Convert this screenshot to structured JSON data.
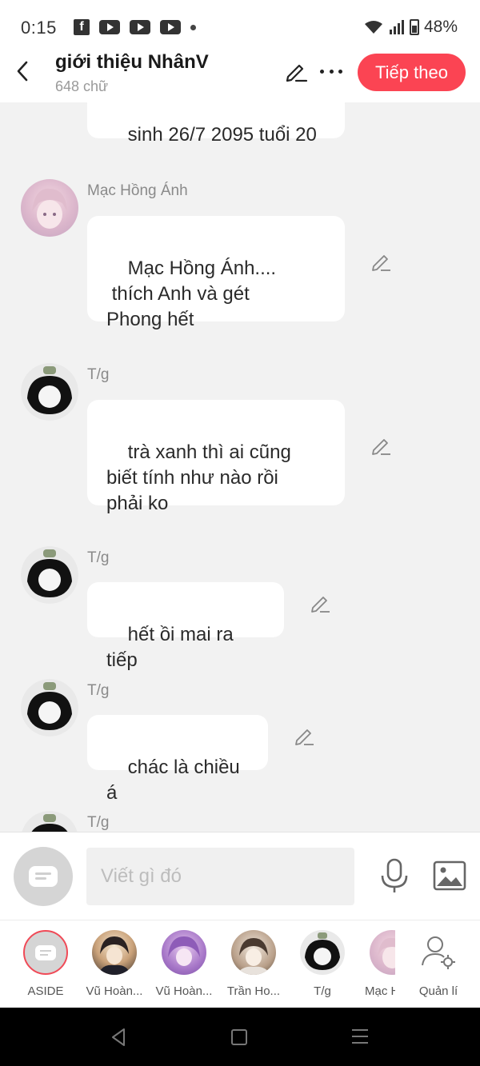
{
  "status_bar": {
    "time": "0:15",
    "battery": "48%"
  },
  "header": {
    "title": "giới thiệu NhânV",
    "word_count": "648 chữ",
    "next_button": "Tiếp theo"
  },
  "chat": {
    "messages": [
      {
        "sender": "",
        "text": "sinh 26/7 2095 tuổi 20"
      },
      {
        "sender": "Mạc Hồng Ánh",
        "text": "Mạc Hồng Ánh....\n thích Anh và gét\nPhong hết"
      },
      {
        "sender": "T/g",
        "text": "trà xanh thì ai cũng\nbiết tính như nào rồi\nphải ko"
      },
      {
        "sender": "T/g",
        "text": "hết ồi mai ra tiếp"
      },
      {
        "sender": "T/g",
        "text": "chác là chiều á"
      },
      {
        "sender": "T/g",
        "text": ""
      }
    ]
  },
  "input": {
    "placeholder": "Viết gì đó"
  },
  "characters": [
    {
      "name": "ASIDE"
    },
    {
      "name": "Vũ Hoàn..."
    },
    {
      "name": "Vũ Hoàn..."
    },
    {
      "name": "Trần Ho..."
    },
    {
      "name": "T/g"
    },
    {
      "name": "Mạc H"
    }
  ],
  "manage_label": "Quản lí",
  "colors": {
    "accent": "#fb4453",
    "background": "#f2f2f2"
  }
}
